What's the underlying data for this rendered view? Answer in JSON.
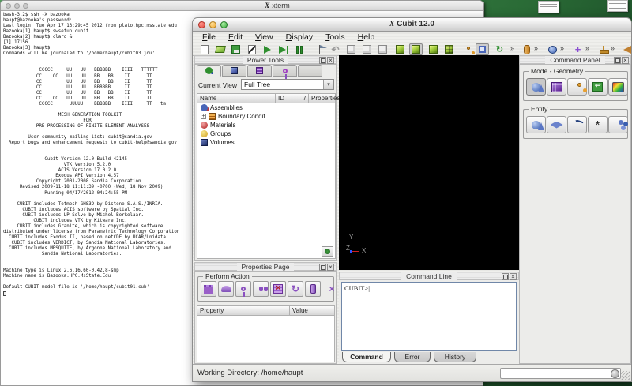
{
  "glyphs": {
    "overflow": "»",
    "dropdown": "▾",
    "close": "×",
    "undo": "↶",
    "refresh": "↻",
    "expand": "+",
    "sort_slash": "/",
    "star": "*",
    "x11": "X",
    "cursor": "|"
  },
  "xterm": {
    "title": "xterm",
    "terminal_text": "bash-3.2$ ssh -X bazooka\nhaupt@bazooka's password: \nLast login: Tue Apr 17 13:29:45 2012 from plato.hpc.msstate.edu\nBazooka[1] haupt$ swsetup cubit\nBazooka[2] haupt$ claro &\n[1] 17156\nBazooka[3] haupt$ \nCommands will be journaled to '/home/haupt/cubit03.jou'\n\n\n             CCCCC     UU   UU   BBBBBB    IIII   TTTTTT\n            CC    CC   UU   UU   BB   BB    II      TT\n            CC         UU   UU   BB   BB    II      TT\n            CC         UU   UU   BBBBBB     II      TT\n            CC         UU   UU   BB   BB    II      TT\n            CC    CC   UU   UU   BB   BB    II      TT\n             CCCCC      UUUUU    BBBBBB    IIII     TT   tm\n\n                    MESH GENERATION TOOLKIT\n                             FOR\n            PRE-PROCESSING OF FINITE ELEMENT ANALYSES\n\n         User community mailing list: cubit@sandia.gov\n  Report bugs and enhancement requests to cubit-help@sandia.gov\n\n\n               Cubit Version 12.0 Build 42145\n                      VTK Version 5.2.0\n                    ACIS Version 17.0.2.0\n                   Exodus API Version 4.57\n            Copyright 2001-2008 Sandia Corporation\n      Revised 2009-11-18 11:11:39 -0700 (Wed, 18 Nov 2009)\n               Running 04/17/2012 04:24:55 PM\n\n     CUBIT includes Tetmesh-GHS3D by Distene S.A.S./INRIA.\n       CUBIT includes ACIS software by Spatial Inc.\n       CUBIT includes LP Solve by Michel Berkelaar.\n           CUBIT includes VTK by Kitware Inc.\n     CUBIT includes Granite, which is copyrighted software\ndistributed under license from Parametric Technology Corporation\n  CUBIT includes Exodus II, based on netCDF by UCAR/Unidata.\n   CUBIT includes VERDICT, by Sandia National Laboratories.\n  CUBIT includes MESQUITE, by Argonne National Laboratory and\n              Sandia National Laboratories.\n\n\nMachine type is Linux 2.6.16.60-0.42.8-smp\nMachine name is Bazooka.HPC.MsState.Edu\n\nDefault CUBIT model file is '/home/haupt/cubit01.cub'"
  },
  "cubit": {
    "window_title": "Cubit 12.0",
    "menu_items": [
      "File",
      "Edit",
      "View",
      "Display",
      "Tools",
      "Help"
    ],
    "toolbar_icons": [
      "new-journal",
      "open",
      "save",
      "edit-journal",
      "play-journal",
      "play-journal-to-end",
      "pause-journal",
      "flag",
      "undo",
      "wireframe-cube",
      "hidden-line-cube",
      "transparent-cube",
      "smooth-shade-cube",
      "shaded-cube",
      "composite-cube",
      "mesh-cube",
      "entity-labels",
      "select-mode",
      "refresh-graphics",
      "surface-toolbar",
      "volume-toolbar",
      "vertex-toolbar",
      "axis-toolbar",
      "cone-toolbar"
    ],
    "power_tools": {
      "title": "Power Tools",
      "tab_icons": [
        "full-tree-tab",
        "geometry-tab",
        "mesh-tab",
        "diagnose-tab",
        "verify-tab"
      ],
      "current_view_label": "Current View",
      "current_view_value": "Full Tree",
      "columns": [
        "Name",
        "ID",
        "Properties"
      ],
      "tree_items": [
        {
          "label": "Assemblies"
        },
        {
          "label": "Boundary Condit..."
        },
        {
          "label": "Materials"
        },
        {
          "label": "Groups"
        },
        {
          "label": "Volumes"
        }
      ]
    },
    "properties_page": {
      "title": "Properties Page",
      "group_label": "Perform Action",
      "action_icons": [
        "histogram",
        "smooth",
        "key",
        "search",
        "delete-mesh",
        "refresh",
        "extrude"
      ],
      "columns": [
        "Property",
        "Value"
      ]
    },
    "command_panel": {
      "title": "Command Panel",
      "mode_group_label": "Mode - Geometry",
      "mode_icons": [
        "geometry-mode",
        "mesh-mode",
        "boundary-conditions-mode",
        "exodus-mode",
        "post-processing-mode"
      ],
      "entity_group_label": "Entity",
      "entity_icons": [
        "volume-entity",
        "surface-entity",
        "curve-entity",
        "vertex-entity",
        "group-entity"
      ]
    },
    "command_line": {
      "title": "Command Line",
      "prompt": "CUBIT>",
      "tabs": [
        "Command",
        "Error",
        "History"
      ]
    },
    "status_bar": {
      "working_directory": "Working Directory: /home/haupt"
    }
  }
}
